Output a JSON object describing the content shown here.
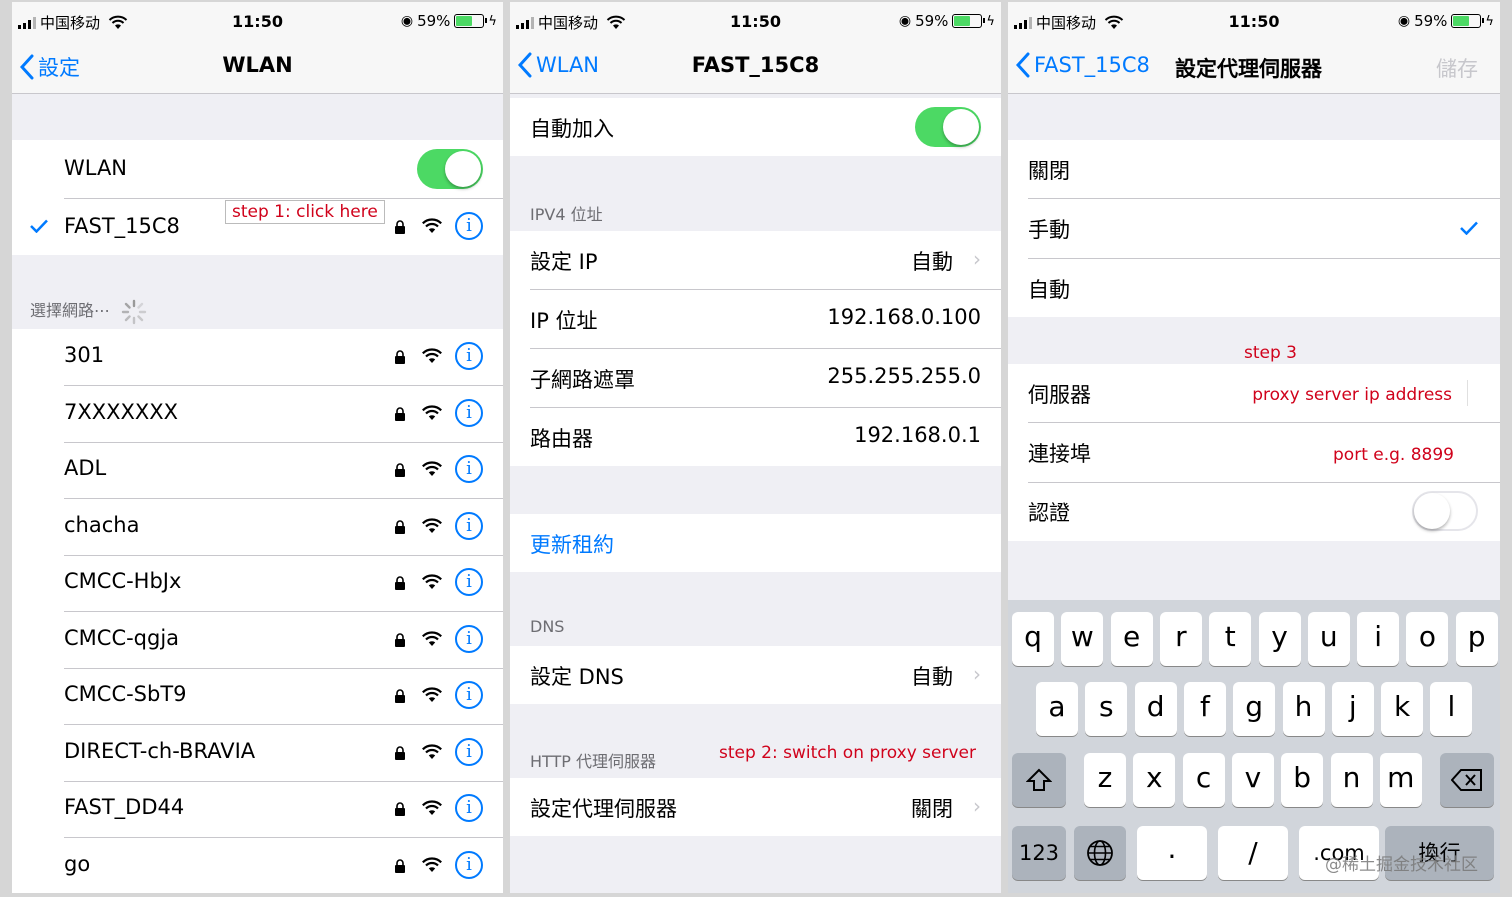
{
  "status": {
    "carrier": "中国移动",
    "time": "11:50",
    "battery": "59%",
    "battery_level": 0.59
  },
  "screen1": {
    "back_label": "設定",
    "title": "WLAN",
    "wlan_label": "WLAN",
    "connected": "FAST_15C8",
    "annotation": "step 1: click here",
    "choose_network": "選擇網路⋯",
    "networks": [
      "301",
      "7XXXXXXX",
      "ADL",
      "chacha",
      "CMCC-HbJx",
      "CMCC-qgja",
      "CMCC-SbT9",
      "DIRECT-ch-BRAVIA",
      "FAST_DD44",
      "go"
    ],
    "info_glyph": "i"
  },
  "screen2": {
    "back_label": "WLAN",
    "title": "FAST_15C8",
    "auto_join": "自動加入",
    "ipv4_header": "IPV4 位址",
    "rows": [
      {
        "label": "設定 IP",
        "value": "自動"
      },
      {
        "label": "IP 位址",
        "value": "192.168.0.100"
      },
      {
        "label": "子網路遮罩",
        "value": "255.255.255.0"
      },
      {
        "label": "路由器",
        "value": "192.168.0.1"
      }
    ],
    "renew": "更新租約",
    "dns_header": "DNS",
    "dns_label": "設定 DNS",
    "dns_value": "自動",
    "proxy_header": "HTTP 代理伺服器",
    "annotation": "step 2: switch on proxy server",
    "proxy_label": "設定代理伺服器",
    "proxy_value": "關閉"
  },
  "screen3": {
    "back_label": "FAST_15C8",
    "title": "設定代理伺服器",
    "save": "儲存",
    "options": [
      "關閉",
      "手動",
      "自動"
    ],
    "step3": "step 3",
    "server_label": "伺服器",
    "server_hint": "proxy server ip address",
    "port_label": "連接埠",
    "port_hint": "port e.g. 8899",
    "auth_label": "認證",
    "keyboard": {
      "row1": [
        "q",
        "w",
        "e",
        "r",
        "t",
        "y",
        "u",
        "i",
        "o",
        "p"
      ],
      "row2": [
        "a",
        "s",
        "d",
        "f",
        "g",
        "h",
        "j",
        "k",
        "l"
      ],
      "row3": [
        "z",
        "x",
        "c",
        "v",
        "b",
        "n",
        "m"
      ],
      "num": "123",
      "dot": ".",
      "slash": "/",
      "com": ".com",
      "go": "換行"
    },
    "watermark": "@稀土掘金技术社区"
  },
  "colors": {
    "accent": "#007aff",
    "toggle_on": "#4cd964",
    "annotation": "#d0021b"
  }
}
